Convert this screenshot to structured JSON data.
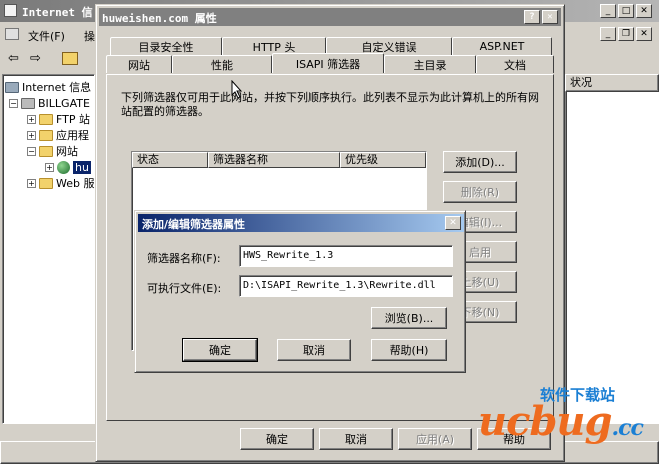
{
  "mmc": {
    "title": "Internet 信",
    "menu": {
      "file": "文件(F)",
      "action": "操"
    },
    "tree": [
      {
        "label": "Internet 信息",
        "expander": ""
      },
      {
        "label": "BILLGATE",
        "expander": "−"
      },
      {
        "label": "FTP 站",
        "expander": "+"
      },
      {
        "label": "应用程",
        "expander": "+"
      },
      {
        "label": "网站",
        "expander": "−"
      },
      {
        "label": "hu",
        "expander": "+"
      },
      {
        "label": "Web 服",
        "expander": "+"
      }
    ],
    "right_header": "状况",
    "bottom_label": "帮助"
  },
  "props": {
    "title": "huweishen.com 属性",
    "help_glyph": "?",
    "close_glyph": "✕",
    "tabs_top": [
      "目录安全性",
      "HTTP 头",
      "自定义错误",
      "ASP.NET"
    ],
    "tabs_bottom": [
      "网站",
      "性能",
      "ISAPI 筛选器",
      "主目录",
      "文档"
    ],
    "description": "下列筛选器仅可用于此网站，并按下列顺序执行。此列表不显示为此计算机上的所有网站配置的筛选器。",
    "columns": [
      "状态",
      "筛选器名称",
      "优先级"
    ],
    "side_buttons": {
      "add": "添加(D)...",
      "remove": "删除(R)",
      "edit": "编辑(I)...",
      "enable": "启用",
      "up": "上移(U)",
      "down": "下移(N)"
    },
    "footer": {
      "ok": "确定",
      "cancel": "取消",
      "apply": "应用(A)",
      "help": "帮助"
    }
  },
  "modal": {
    "title": "添加/编辑筛选器属性",
    "close_glyph": "✕",
    "name_label": "筛选器名称(F):",
    "name_value": "HWS_Rewrite_1.3",
    "exec_label": "可执行文件(E):",
    "exec_value": "D:\\ISAPI_Rewrite_1.3\\Rewrite.dll",
    "browse": "浏览(B)...",
    "ok": "确定",
    "cancel": "取消",
    "help": "帮助(H)"
  },
  "watermark": {
    "logo": "ucbug",
    "suffix": ".cc",
    "tagline": "软件下载站"
  },
  "colors": {
    "face": "#d4d0c8",
    "active_title": "#0a246a",
    "inactive_title": "#808080",
    "watermark_orange": "#ee6b1f",
    "watermark_blue": "#1a7fd4"
  }
}
